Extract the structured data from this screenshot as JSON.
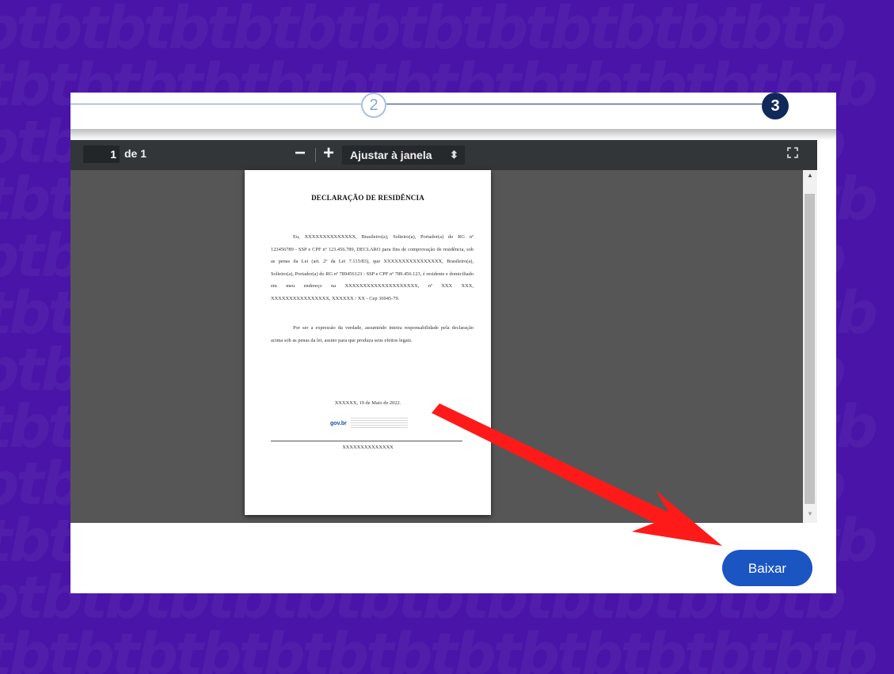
{
  "stepper": {
    "step2": "2",
    "step3": "3"
  },
  "toolbar": {
    "page_current": "1",
    "page_of": "de 1",
    "zoom_out": "−",
    "zoom_in": "+",
    "zoom_select": "Ajustar à janela",
    "zoom_select_arrow": "⬍",
    "fullscreen_icon": "fullscreen-icon"
  },
  "document": {
    "title": "DECLARAÇÃO DE RESIDÊNCIA",
    "paragraph1": "Eu, XXXXXXXXXXXXXX, Brasileiro(a), Solteiro(a), Portador(a) do RG nº 123456789 - SSP e CPF nº 123.456.789, DECLARO para fins de comprovação de residência, sob as penas da Lei (art. 2º da Lei 7.115/83), que XXXXXXXXXXXXXXXX, Brasileiro(a), Solteiro(a), Portador(a) do RG nº 789456123 - SSP e CPF nº 789.456.123, é residente e domiciliado em meu endereço na XXXXXXXXXXXXXXXXXXXX, nº XXX XXX, XXXXXXXXXXXXXXXX, XXXXXX / XX - Cep 36945-79.",
    "paragraph2": "Por ser a expressão da verdade, assumindo inteira responsabilidade pela declaração acima sob as penas da lei, assino para que produza seus efeitos legais.",
    "date": "XXXXXX, 19 de Maio de 2022.",
    "gov_logo": "gov.br",
    "signature_name": "XXXXXXXXXXXXXX"
  },
  "actions": {
    "download_label": "Baixar"
  },
  "colors": {
    "background": "#4a14a8",
    "primary_button": "#1a55c2",
    "step_active": "#10285a",
    "arrow": "#ff1a1a"
  }
}
